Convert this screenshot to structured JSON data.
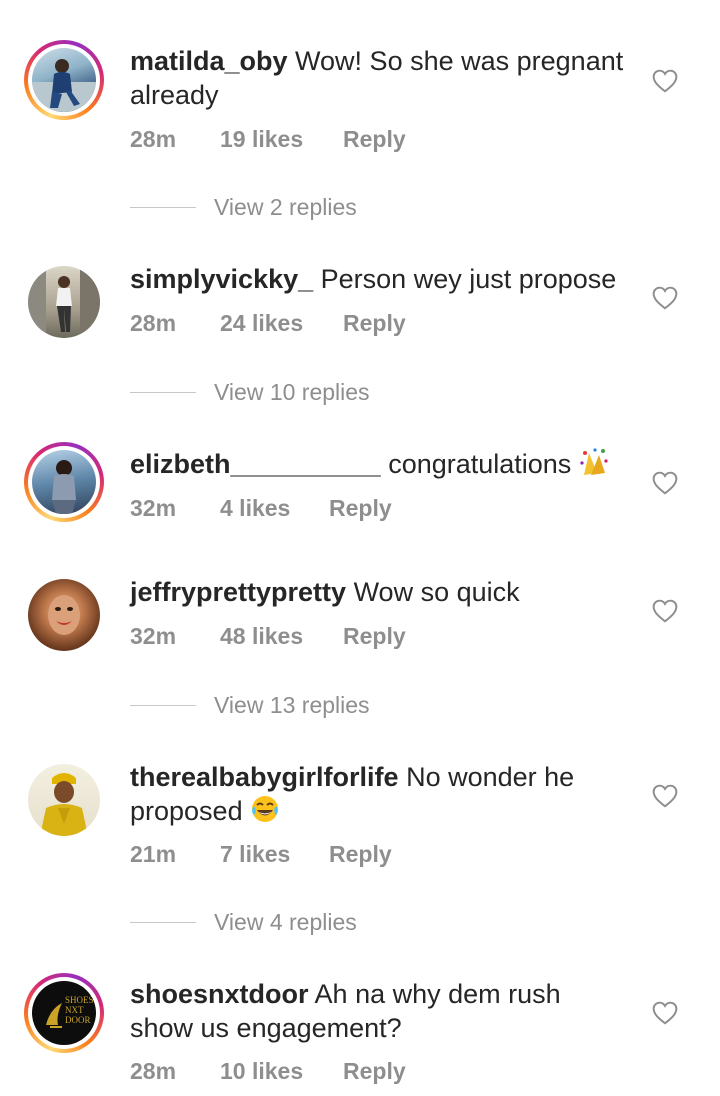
{
  "comments": [
    {
      "username": "matilda_oby",
      "text_line1": " Wow! So she was pregnant",
      "text_line2": "already",
      "time": "28m",
      "likes": "19 likes",
      "reply": "Reply",
      "has_story_ring": true,
      "view_replies": "View 2 replies"
    },
    {
      "username": "simplyvickky_",
      "text_line1": " Person wey just propose",
      "time": "28m",
      "likes": "24 likes",
      "reply": "Reply",
      "has_story_ring": false,
      "view_replies": "View 10 replies"
    },
    {
      "username": "elizbeth__________",
      "text_line1": " congratulations",
      "emoji": "confetti-emoji",
      "time": "32m",
      "likes": "4 likes",
      "reply": "Reply",
      "has_story_ring": true
    },
    {
      "username": "jeffryprettypretty",
      "text_line1": " Wow so quick",
      "time": "32m",
      "likes": "48 likes",
      "reply": "Reply",
      "has_story_ring": false,
      "view_replies": "View 13 replies"
    },
    {
      "username": "therealbabygirlforlife",
      "text_line1": " No wonder he",
      "text_line2": "proposed",
      "emoji": "laughing-tears-emoji",
      "time": "21m",
      "likes": "7 likes",
      "reply": "Reply",
      "has_story_ring": false,
      "view_replies": "View 4 replies"
    },
    {
      "username": "shoesnxtdoor",
      "text_line1": " Ah na why dem rush",
      "text_line2": "show us engagement?",
      "time": "28m",
      "likes": "10 likes",
      "reply": "Reply",
      "has_story_ring": true,
      "avatar_logo": {
        "line1": "SHOES",
        "line2": "NXT",
        "line3": "DOOR"
      }
    }
  ],
  "icons": {
    "like": "heart-outline-icon"
  },
  "colors": {
    "text": "#262626",
    "muted": "#8e8e8e",
    "divider": "#c7c7c7",
    "ring_start": "#feda75",
    "ring_end": "#962fbf"
  }
}
